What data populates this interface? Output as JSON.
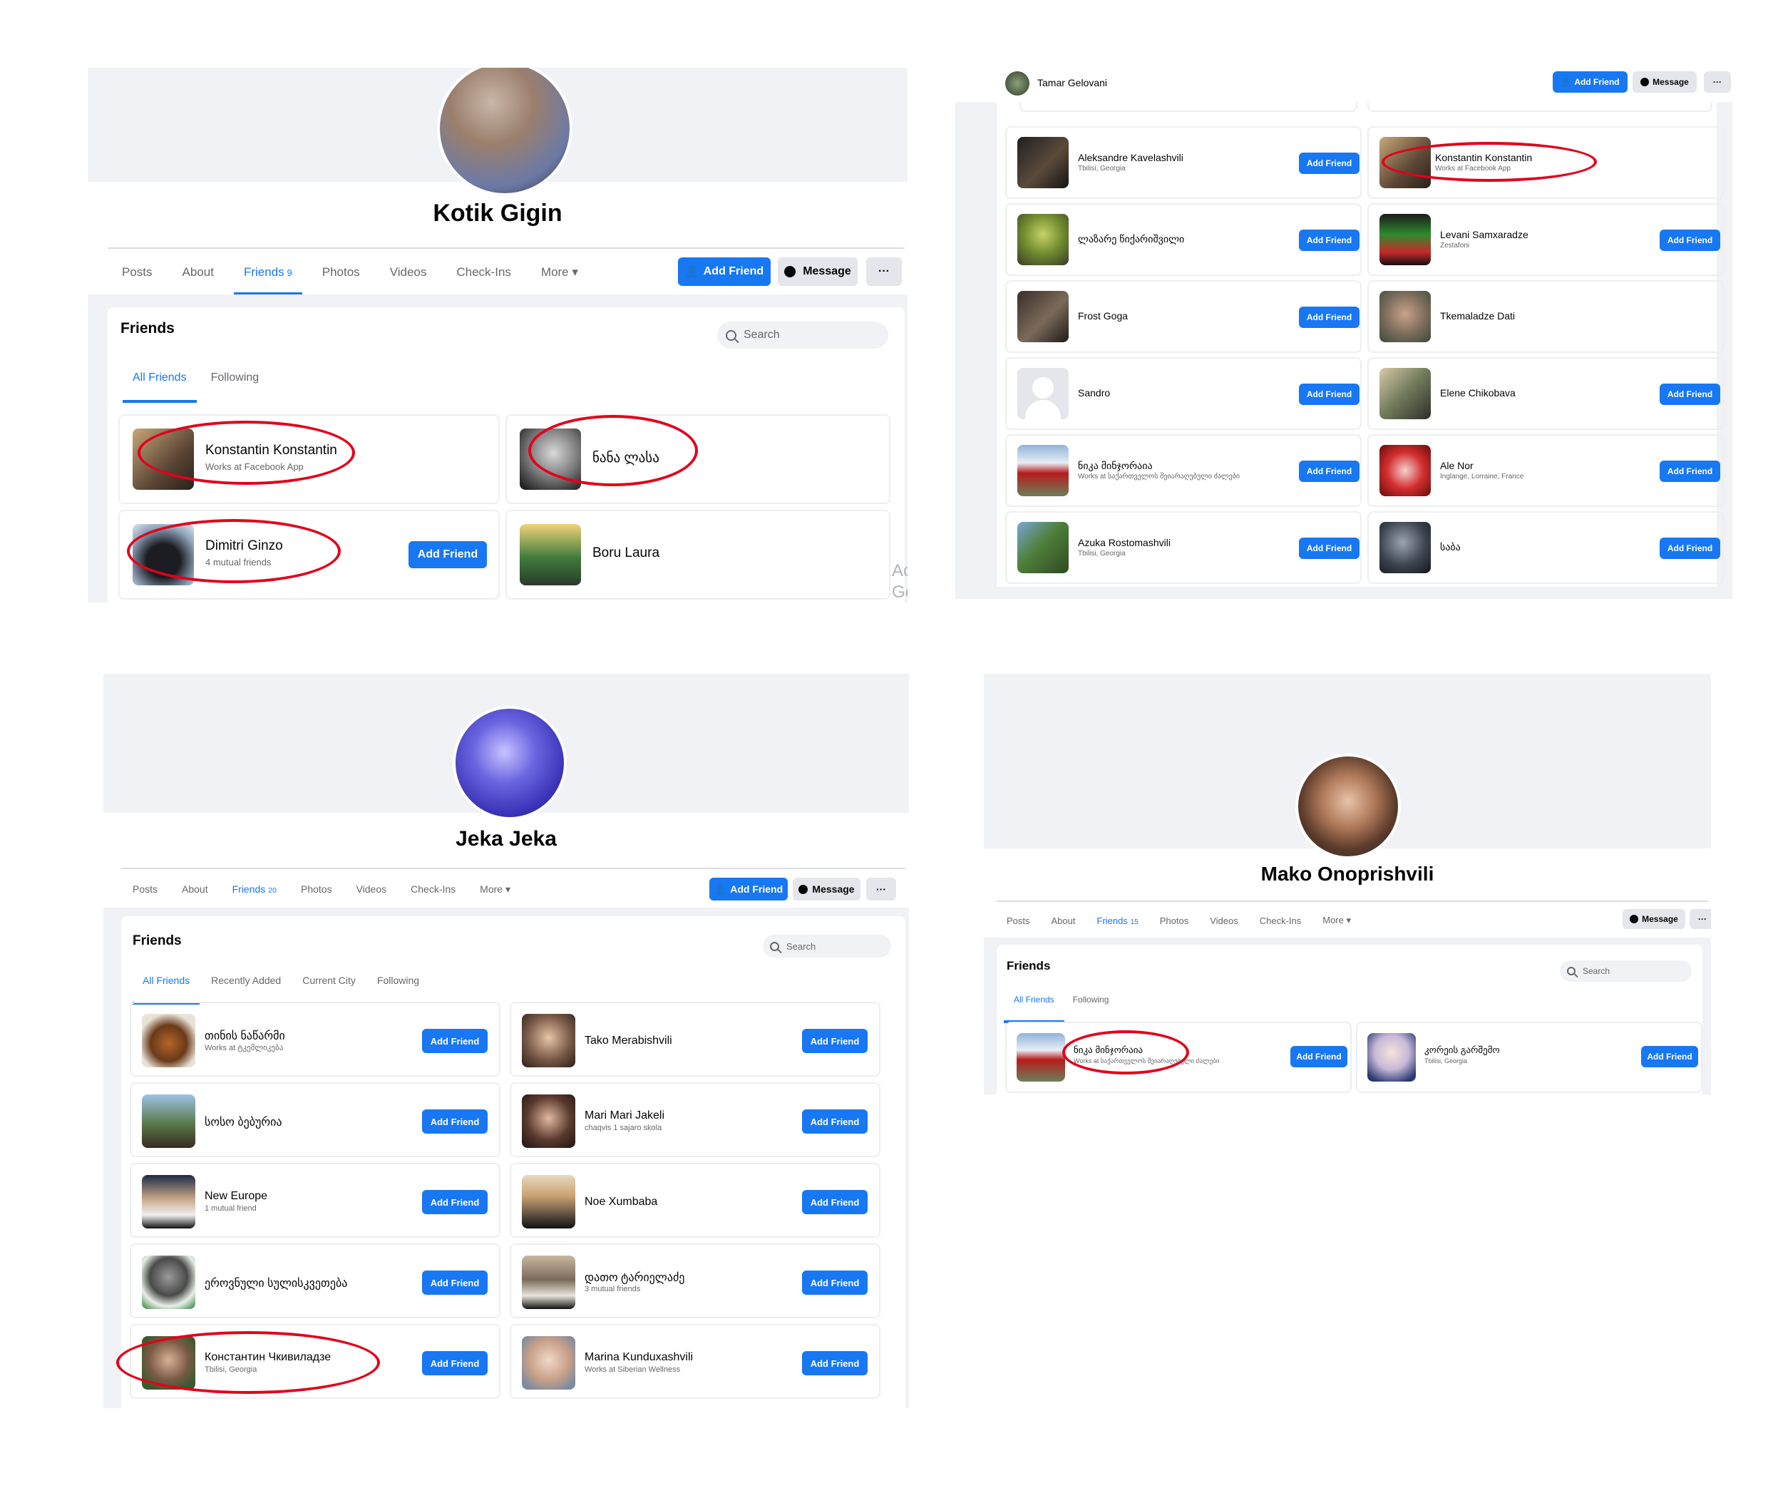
{
  "colors": {
    "accent": "#1877f2",
    "annotation": "#e3001b",
    "background": "#f0f2f5"
  },
  "p1": {
    "name": "Kotik Gigin",
    "tabs": [
      "Posts",
      "About",
      "Friends",
      "Photos",
      "Videos",
      "Check-Ins",
      "More ▾"
    ],
    "friends_count": "9",
    "add_friend": "Add Friend",
    "message": "Message",
    "more_dots": "···",
    "section_title": "Friends",
    "search_placeholder": "Search",
    "subtabs": [
      "All Friends",
      "Following"
    ],
    "cards": [
      {
        "name": "Konstantin Konstantin",
        "sub": "Works at Facebook App",
        "button": ""
      },
      {
        "name": "ნანა ლასა",
        "sub": "",
        "button": ""
      },
      {
        "name": "Dimitri Ginzo",
        "sub": "4 mutual friends",
        "button": "Add Friend"
      },
      {
        "name": "Boru Laura",
        "sub": "",
        "button": ""
      }
    ],
    "edge_text": [
      "Ac",
      "Go"
    ]
  },
  "p2": {
    "header_name": "Tamar Gelovani",
    "add_friend": "Add Friend",
    "message": "Message",
    "more_dots": "···",
    "cards": [
      {
        "name": "Aleksandre Kavelashvili",
        "sub": "Tbilisi, Georgia",
        "button": "Add Friend"
      },
      {
        "name": "Konstantin Konstantin",
        "sub": "Works at Facebook App",
        "button": ""
      },
      {
        "name": "ლაზარე წიქარიშვილი",
        "sub": "",
        "button": "Add Friend"
      },
      {
        "name": "Levani Samxaradze",
        "sub": "Zestafoni",
        "button": "Add Friend"
      },
      {
        "name": "Frost Goga",
        "sub": "",
        "button": "Add Friend"
      },
      {
        "name": "Tkemaladze Dati",
        "sub": "",
        "button": ""
      },
      {
        "name": "Sandro",
        "sub": "",
        "button": "Add Friend"
      },
      {
        "name": "Elene Chikobava",
        "sub": "",
        "button": "Add Friend"
      },
      {
        "name": "ნიკა მინჯორაია",
        "sub": "Works at საქართველოს შეიარაღებული ძალები",
        "button": "Add Friend"
      },
      {
        "name": "Ale Nor",
        "sub": "Inglange, Lorraine, France",
        "button": "Add Friend"
      },
      {
        "name": "Azuka Rostomashvili",
        "sub": "Tbilisi, Georgia",
        "button": "Add Friend"
      },
      {
        "name": "საბა",
        "sub": "",
        "button": "Add Friend"
      }
    ]
  },
  "p3": {
    "name": "Jeka Jeka",
    "tabs": [
      "Posts",
      "About",
      "Friends",
      "Photos",
      "Videos",
      "Check-Ins",
      "More ▾"
    ],
    "friends_count": "20",
    "add_friend": "Add Friend",
    "message": "Message",
    "more_dots": "···",
    "section_title": "Friends",
    "search_placeholder": "Search",
    "subtabs": [
      "All Friends",
      "Recently Added",
      "Current City",
      "Following"
    ],
    "cards": [
      {
        "name": "თინის ნაწარმი",
        "sub": "Works at ტკემლიკება",
        "button": "Add Friend"
      },
      {
        "name": "Tako Merabishvili",
        "sub": "",
        "button": "Add Friend"
      },
      {
        "name": "სოსო ბებურია",
        "sub": "",
        "button": "Add Friend"
      },
      {
        "name": "Mari Mari Jakeli",
        "sub": "chaqvis 1 sajaro skola",
        "button": "Add Friend"
      },
      {
        "name": "New Europe",
        "sub": "1 mutual friend",
        "button": "Add Friend"
      },
      {
        "name": "Noe Xumbaba",
        "sub": "",
        "button": "Add Friend"
      },
      {
        "name": "ეროვნული სულისკვეთება",
        "sub": "",
        "button": "Add Friend"
      },
      {
        "name": "დათო ტარიელაძე",
        "sub": "3 mutual friends",
        "button": "Add Friend"
      },
      {
        "name": "Константин Чкивиладзе",
        "sub": "Tbilisi, Georgia",
        "button": "Add Friend"
      },
      {
        "name": "Marina Kunduxashvili",
        "sub": "Works at Siberian Wellness",
        "button": "Add Friend"
      }
    ]
  },
  "p4": {
    "name": "Mako Onoprishvili",
    "tabs": [
      "Posts",
      "About",
      "Friends",
      "Photos",
      "Videos",
      "Check-Ins",
      "More ▾"
    ],
    "friends_count": "15",
    "message": "Message",
    "more_dots": "···",
    "section_title": "Friends",
    "search_placeholder": "Search",
    "subtabs": [
      "All Friends",
      "Following"
    ],
    "cards": [
      {
        "name": "ნიკა მინჯორაია",
        "sub": "Works at საქართველოს შეიარაღებული ძალები",
        "button": "Add Friend"
      },
      {
        "name": "კორეის გარშემო",
        "sub": "Tbilisi, Georgia",
        "button": "Add Friend"
      }
    ]
  }
}
